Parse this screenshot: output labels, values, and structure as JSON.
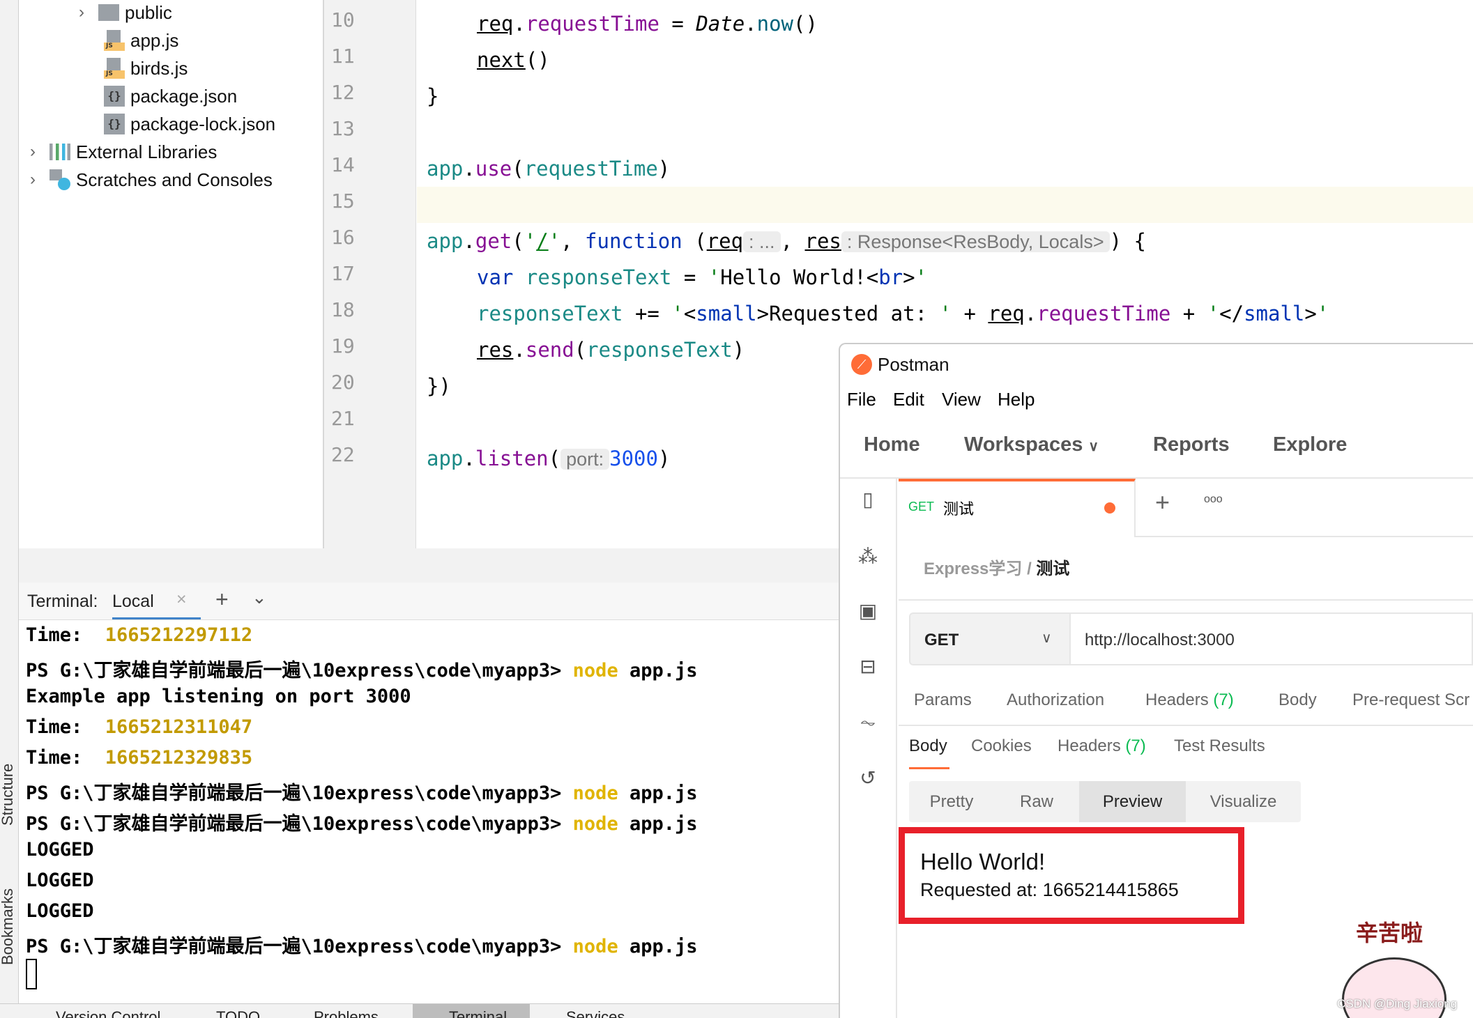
{
  "sidebar_strip": {
    "structure": "Structure",
    "bookmarks": "Bookmarks"
  },
  "project_tree": [
    {
      "label": "public",
      "type": "folder",
      "collapsed": true
    },
    {
      "label": "app.js",
      "type": "js"
    },
    {
      "label": "birds.js",
      "type": "js"
    },
    {
      "label": "package.json",
      "type": "json"
    },
    {
      "label": "package-lock.json",
      "type": "json"
    },
    {
      "label": "External Libraries",
      "type": "libraries",
      "collapsed": true
    },
    {
      "label": "Scratches and Consoles",
      "type": "scratches",
      "collapsed": true
    }
  ],
  "editor": {
    "line_numbers": [
      "10",
      "11",
      "12",
      "13",
      "14",
      "15",
      "16",
      "17",
      "18",
      "19",
      "20",
      "21",
      "22"
    ],
    "current_line": "15",
    "hints": {
      "req": ": ...",
      "res": ": Response<ResBody, Locals>",
      "port": "port:"
    }
  },
  "terminal": {
    "label": "Terminal:",
    "tab": "Local",
    "lines": [
      {
        "prefix": "Time:  ",
        "value": "1665212297112"
      },
      {
        "prompt": "PS G:\\丁家雄自学前端最后一遍\\10express\\code\\myapp3> ",
        "cmd": "node",
        "args": " app.js"
      },
      {
        "text": "Example app listening on port 3000"
      },
      {
        "prefix": "Time:  ",
        "value": "1665212311047"
      },
      {
        "prefix": "Time:  ",
        "value": "1665212329835"
      },
      {
        "prompt": "PS G:\\丁家雄自学前端最后一遍\\10express\\code\\myapp3> ",
        "cmd": "node",
        "args": " app.js"
      },
      {
        "prompt": "PS G:\\丁家雄自学前端最后一遍\\10express\\code\\myapp3> ",
        "cmd": "node",
        "args": " app.js"
      },
      {
        "text": "LOGGED"
      },
      {
        "text": "LOGGED"
      },
      {
        "text": "LOGGED"
      },
      {
        "prompt": "PS G:\\丁家雄自学前端最后一遍\\10express\\code\\myapp3> ",
        "cmd": "node",
        "args": " app.js"
      }
    ]
  },
  "bottom_bar": [
    "Version Control",
    "TODO",
    "Problems",
    "Terminal",
    "Services"
  ],
  "postman": {
    "title": "Postman",
    "menu": [
      "File",
      "Edit",
      "View",
      "Help"
    ],
    "nav": [
      "Home",
      "Workspaces",
      "Reports",
      "Explore"
    ],
    "tab": {
      "method": "GET",
      "name": "测试"
    },
    "breadcrumb": {
      "collection": "Express学习",
      "sep": "/",
      "request": "测试"
    },
    "method": "GET",
    "url": "http://localhost:3000",
    "request_tabs": [
      {
        "label": "Params"
      },
      {
        "label": "Authorization"
      },
      {
        "label": "Headers",
        "count": "(7)"
      },
      {
        "label": "Body"
      },
      {
        "label": "Pre-request Scr"
      }
    ],
    "response_tabs": [
      {
        "label": "Body"
      },
      {
        "label": "Cookies"
      },
      {
        "label": "Headers",
        "count": "(7)"
      },
      {
        "label": "Test Results"
      }
    ],
    "view_modes": [
      "Pretty",
      "Raw",
      "Preview",
      "Visualize"
    ],
    "active_view": "Preview",
    "preview": {
      "heading": "Hello World!",
      "small": "Requested at: 1665214415865"
    },
    "accent": "#ff6c37"
  },
  "sticker": {
    "text": "辛苦啦"
  },
  "watermark": "CSDN @Ding Jiaxiong"
}
